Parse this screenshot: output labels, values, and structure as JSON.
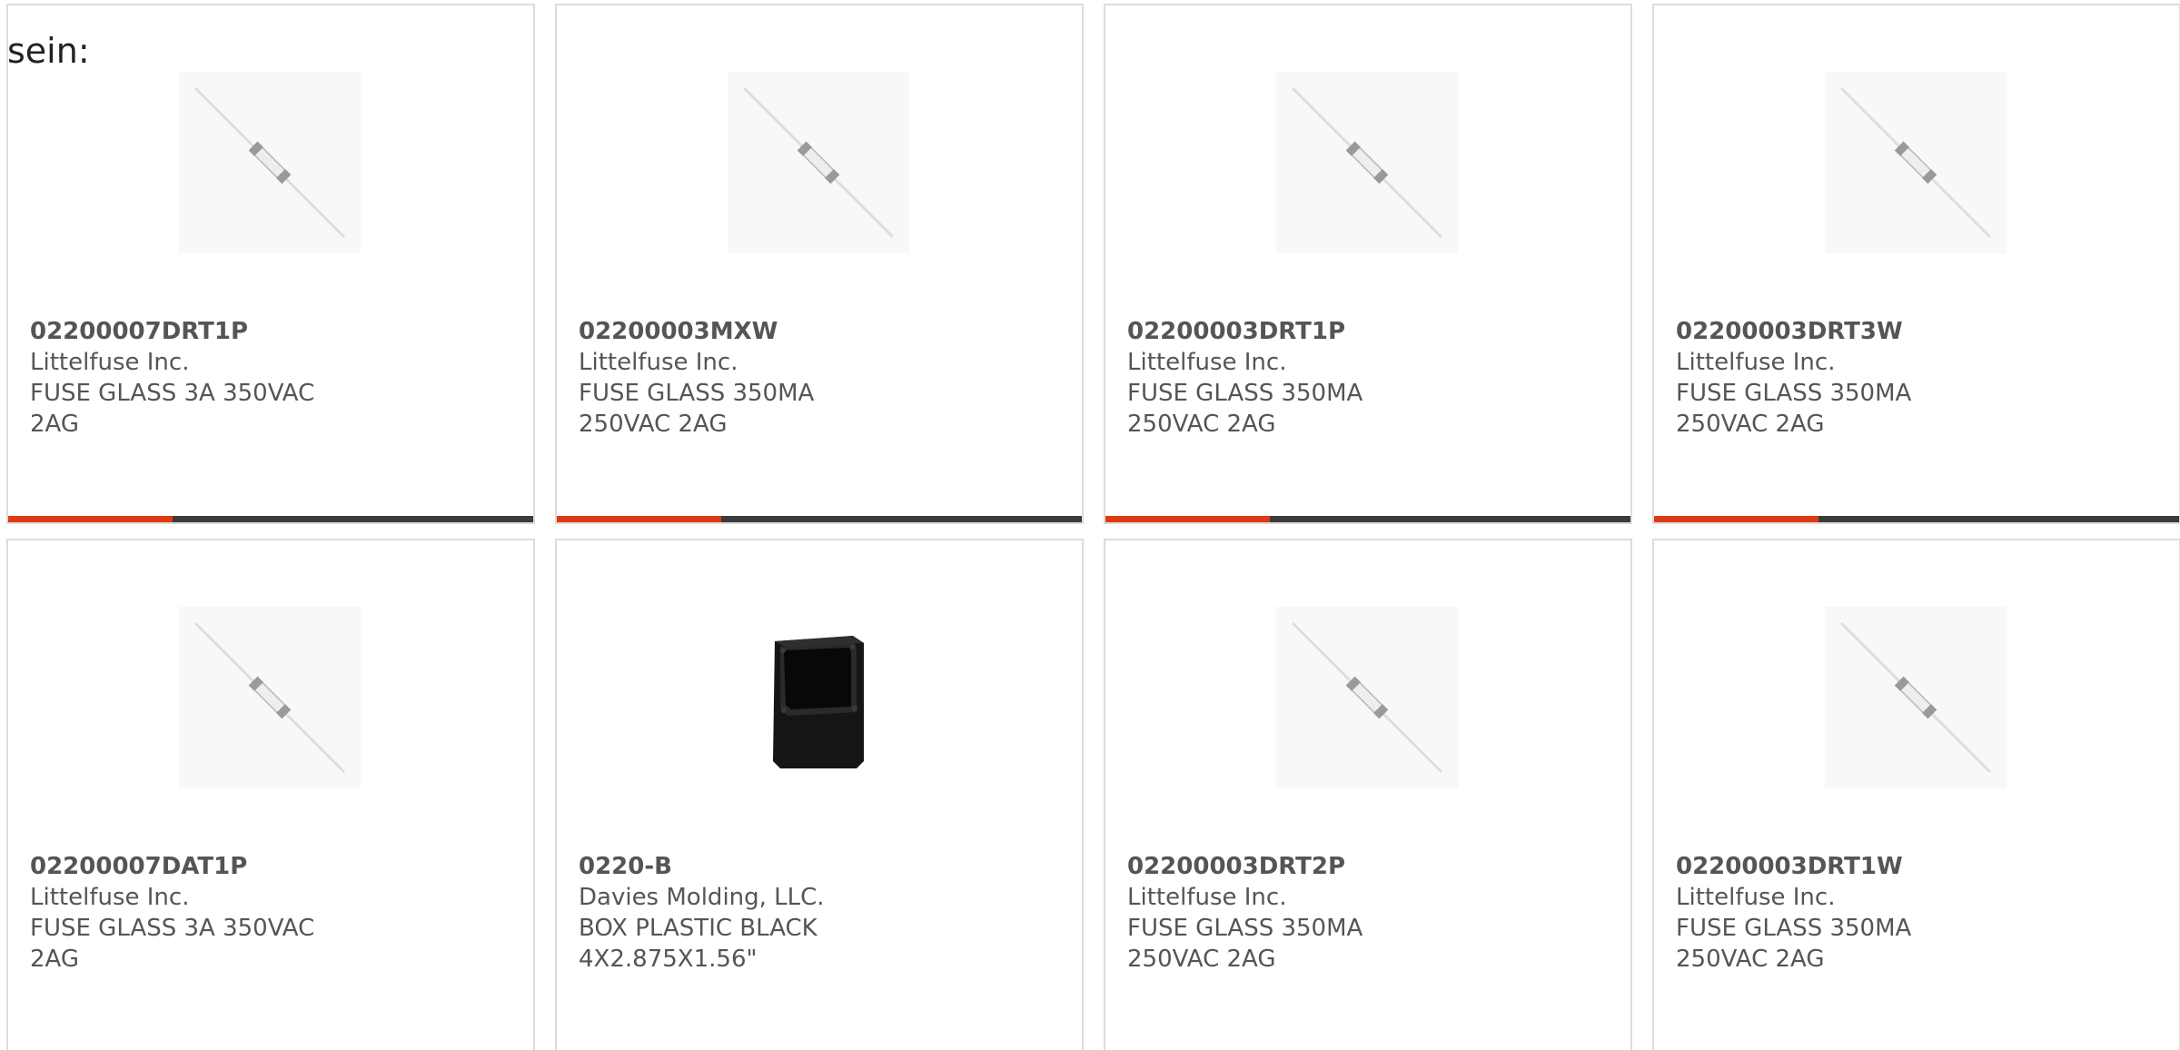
{
  "lead_text": "sein:",
  "colors": {
    "accent": "#e03a12",
    "bar": "#3b3b3b",
    "border": "#dcdcdc",
    "text": "#555555"
  },
  "products": [
    {
      "part": "02200007DRT1P",
      "maker": "Littelfuse Inc.",
      "desc": "FUSE GLASS 3A 350VAC 2AG",
      "image": "glass-fuse"
    },
    {
      "part": "02200003MXW",
      "maker": "Littelfuse Inc.",
      "desc": "FUSE GLASS 350MA 250VAC 2AG",
      "image": "glass-fuse"
    },
    {
      "part": "02200003DRT1P",
      "maker": "Littelfuse Inc.",
      "desc": "FUSE GLASS 350MA 250VAC 2AG",
      "image": "glass-fuse"
    },
    {
      "part": "02200003DRT3W",
      "maker": "Littelfuse Inc.",
      "desc": "FUSE GLASS 350MA 250VAC 2AG",
      "image": "glass-fuse"
    },
    {
      "part": "02200007DAT1P",
      "maker": "Littelfuse Inc.",
      "desc": "FUSE GLASS 3A 350VAC 2AG",
      "image": "glass-fuse"
    },
    {
      "part": "0220-B",
      "maker": "Davies Molding, LLC.",
      "desc": "BOX PLASTIC BLACK 4X2.875X1.56\"",
      "image": "plastic-box"
    },
    {
      "part": "02200003DRT2P",
      "maker": "Littelfuse Inc.",
      "desc": "FUSE GLASS 350MA 250VAC 2AG",
      "image": "glass-fuse"
    },
    {
      "part": "02200003DRT1W",
      "maker": "Littelfuse Inc.",
      "desc": "FUSE GLASS 350MA 250VAC 2AG",
      "image": "glass-fuse"
    }
  ]
}
